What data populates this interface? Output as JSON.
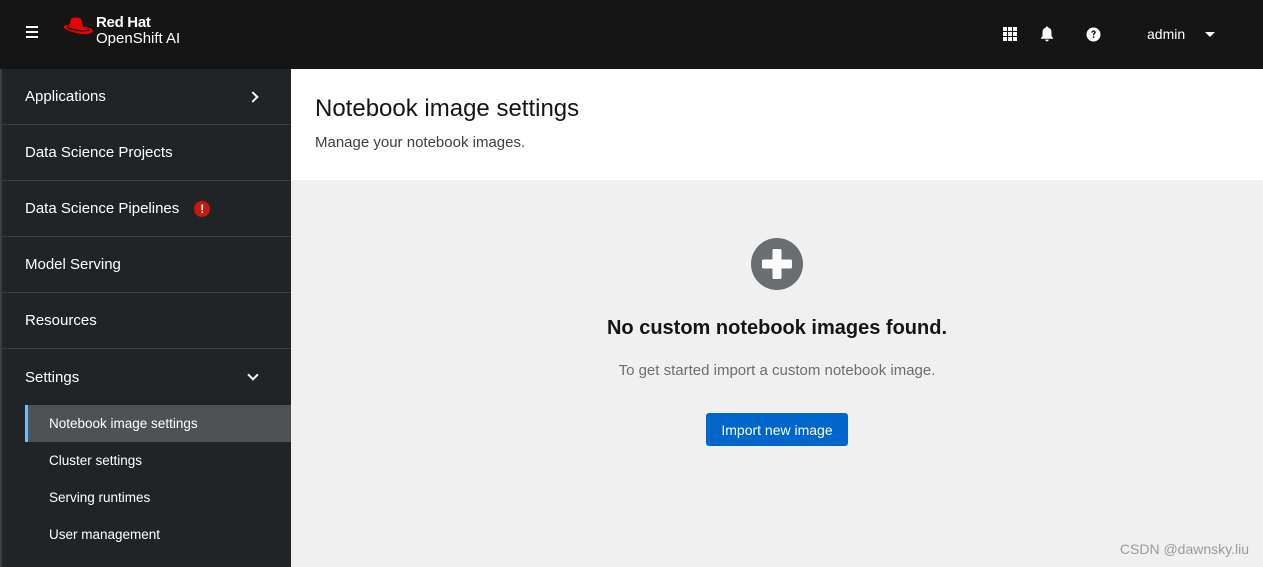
{
  "masthead": {
    "brand_top": "Red Hat",
    "brand_product": "OpenShift AI",
    "icons": {
      "menu": "hamburger-icon",
      "apps": "grid-icon",
      "notifications": "bell-icon",
      "help": "question-circle-icon"
    },
    "user": "admin"
  },
  "sidebar": {
    "items": [
      {
        "label": "Applications",
        "icon": "chevron-right-icon"
      },
      {
        "label": "Data Science Projects"
      },
      {
        "label": "Data Science Pipelines",
        "badge": "!",
        "badge_icon": "exclamation-circle-icon"
      },
      {
        "label": "Model Serving"
      },
      {
        "label": "Resources"
      },
      {
        "label": "Settings",
        "icon": "chevron-down-icon",
        "expanded": true
      }
    ],
    "settings_children": [
      {
        "label": "Notebook image settings",
        "active": true
      },
      {
        "label": "Cluster settings"
      },
      {
        "label": "Serving runtimes"
      },
      {
        "label": "User management"
      }
    ]
  },
  "page": {
    "title": "Notebook image settings",
    "description": "Manage your notebook images."
  },
  "empty_state": {
    "icon": "plus-circle-icon",
    "title": "No custom notebook images found.",
    "body": "To get started import a custom notebook image.",
    "button": "Import new image"
  },
  "colors": {
    "masthead_bg": "#151515",
    "sidebar_bg": "#212427",
    "active_item_bg": "#4f5255",
    "active_indicator": "#73bcf7",
    "primary_button": "#0066cc",
    "alert": "#c9190b",
    "brand_red": "#ee0000"
  },
  "watermark": "CSDN @dawnsky.liu"
}
